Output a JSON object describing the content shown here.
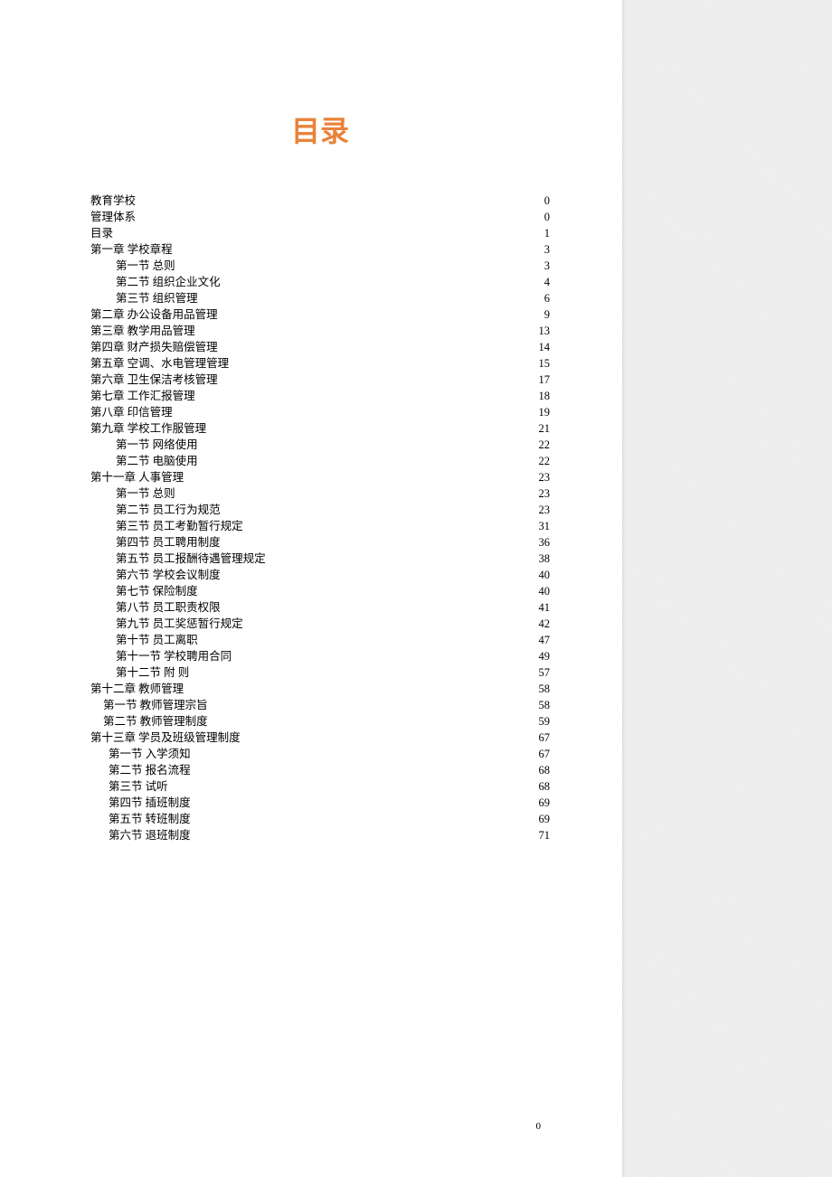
{
  "title": "目录",
  "page_number": "0",
  "toc": [
    {
      "level": 1,
      "label": "教育学校",
      "page": "0"
    },
    {
      "level": 1,
      "label": "管理体系",
      "page": "0"
    },
    {
      "level": 1,
      "label": "目录",
      "page": "1"
    },
    {
      "level": 1,
      "label": "第一章  学校章程",
      "page": "3"
    },
    {
      "level": 2,
      "label": "第一节  总则",
      "page": "3"
    },
    {
      "level": 2,
      "label": "第二节  组织企业文化",
      "page": "4"
    },
    {
      "level": 2,
      "label": "第三节  组织管理",
      "page": "6"
    },
    {
      "level": 1,
      "label": "第二章  办公设备用品管理",
      "page": "9"
    },
    {
      "level": 1,
      "label": "第三章  教学用品管理",
      "page": "13"
    },
    {
      "level": 1,
      "label": "第四章  财产损失赔偿管理",
      "page": "14"
    },
    {
      "level": 1,
      "label": "第五章  空调、水电管理管理",
      "page": "15"
    },
    {
      "level": 1,
      "label": "第六章  卫生保洁考核管理",
      "page": "17"
    },
    {
      "level": 1,
      "label": "第七章  工作汇报管理",
      "page": "18"
    },
    {
      "level": 1,
      "label": "第八章  印信管理",
      "page": "19"
    },
    {
      "level": 1,
      "label": "第九章  学校工作服管理",
      "page": "21"
    },
    {
      "level": 2,
      "label": "第一节  网络使用",
      "page": "22"
    },
    {
      "level": 2,
      "label": "第二节  电脑使用",
      "page": "22"
    },
    {
      "level": 1,
      "label": "第十一章  人事管理",
      "page": "23"
    },
    {
      "level": 2,
      "label": "第一节  总则",
      "page": "23"
    },
    {
      "level": 2,
      "label": "第二节  员工行为规范",
      "page": "23"
    },
    {
      "level": 2,
      "label": "第三节  员工考勤暂行规定",
      "page": "31"
    },
    {
      "level": 2,
      "label": "第四节  员工聘用制度",
      "page": "36"
    },
    {
      "level": 2,
      "label": "第五节  员工报酬待遇管理规定",
      "page": "38"
    },
    {
      "level": 2,
      "label": "第六节  学校会议制度",
      "page": "40"
    },
    {
      "level": 2,
      "label": "第七节  保险制度",
      "page": "40"
    },
    {
      "level": 2,
      "label": "第八节  员工职责权限",
      "page": "41"
    },
    {
      "level": 2,
      "label": "第九节  员工奖惩暂行规定",
      "page": "42"
    },
    {
      "level": 2,
      "label": "第十节  员工离职",
      "page": "47"
    },
    {
      "level": 2,
      "label": "第十一节    学校聘用合同",
      "page": "49"
    },
    {
      "level": 2,
      "label": "第十二节  附  则",
      "page": "57"
    },
    {
      "level": 1,
      "label": "第十二章  教师管理",
      "page": "58"
    },
    {
      "level": "2b",
      "label": "第一节  教师管理宗旨",
      "page": "58"
    },
    {
      "level": "2b",
      "label": "第二节  教师管理制度",
      "page": "59"
    },
    {
      "level": 1,
      "label": "第十三章  学员及班级管理制度",
      "page": "67"
    },
    {
      "level": "2c",
      "label": "第一节     入学须知",
      "page": "67"
    },
    {
      "level": "2c",
      "label": "第二节     报名流程",
      "page": "68"
    },
    {
      "level": "2c",
      "label": "第三节     试听",
      "page": "68"
    },
    {
      "level": "2c",
      "label": "第四节     插班制度",
      "page": "69"
    },
    {
      "level": "2c",
      "label": "第五节     转班制度",
      "page": "69"
    },
    {
      "level": "2c",
      "label": "第六节     退班制度",
      "page": "71"
    }
  ]
}
